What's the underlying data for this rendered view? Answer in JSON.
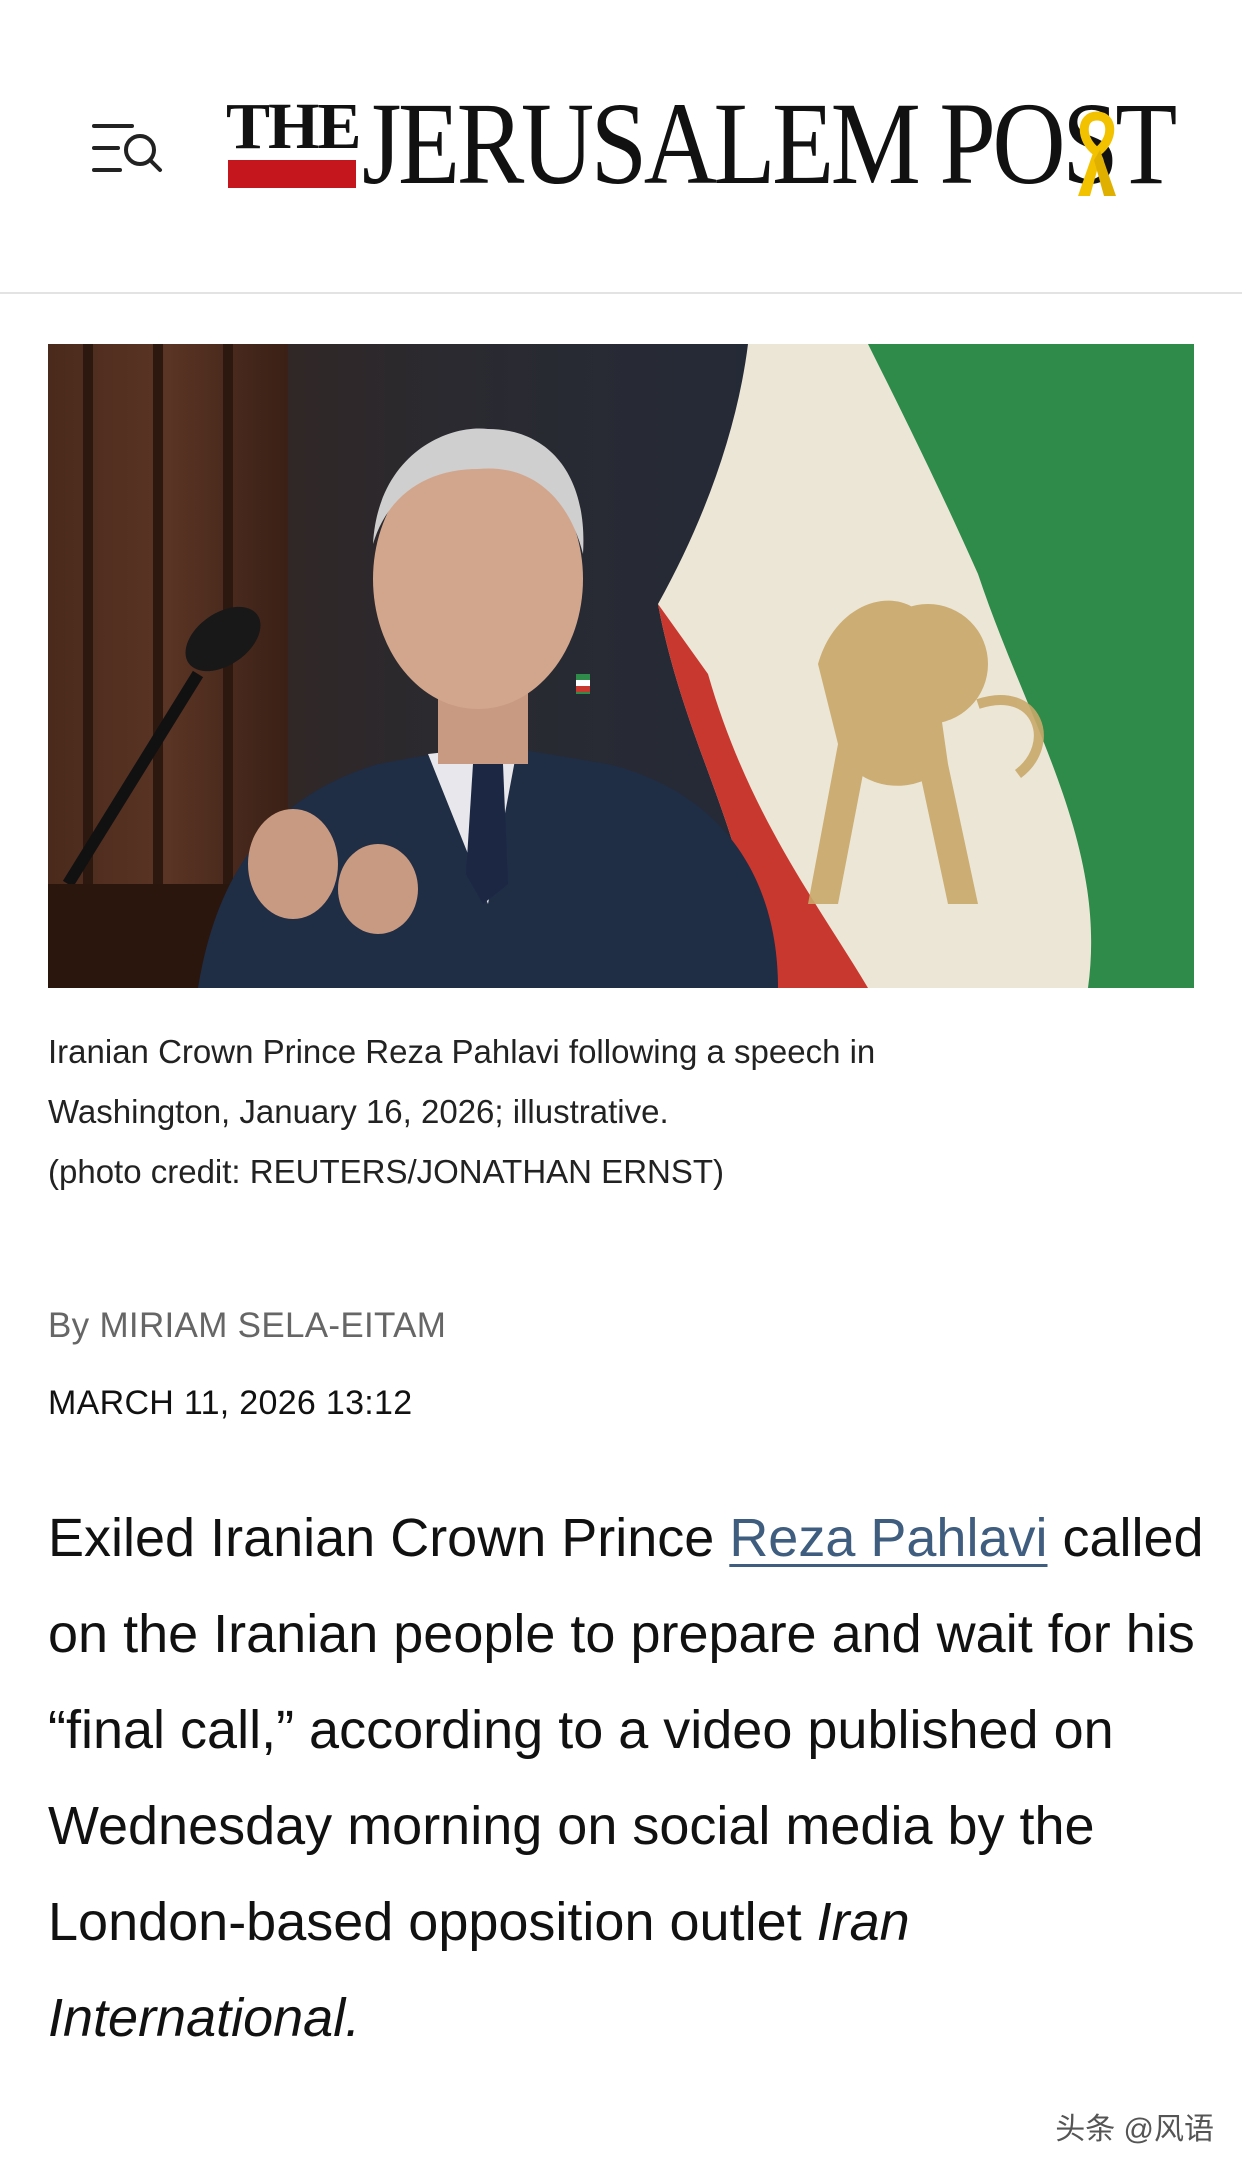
{
  "header": {
    "logo_the": "THE",
    "logo_name": "JERUSALEM POST"
  },
  "hero": {
    "colors": {
      "flag_green": "#2e8b4a",
      "flag_white": "#ece6d6",
      "flag_red": "#c9382f",
      "emblem_gold": "#c9a86a",
      "suit": "#1f2d45",
      "background": "#24324a"
    }
  },
  "caption": {
    "line1": "Iranian Crown Prince Reza Pahlavi following a speech in",
    "line2": "Washington, January 16, 2026; illustrative.",
    "line3": "(photo credit: REUTERS/JONATHAN ERNST)"
  },
  "article": {
    "byline": "By MIRIAM SELA-EITAM",
    "date": "MARCH 11, 2026 13:12",
    "body_part1": "Exiled Iranian Crown Prince ",
    "body_link": "Reza Pahlavi",
    "body_part2": " called on the Iranian people to prepare and wait for his “final call,” according to a video published on Wednesday morning on social media by the London-based opposition outlet ",
    "body_italic": "Iran International."
  },
  "watermark": "头条 @风语"
}
